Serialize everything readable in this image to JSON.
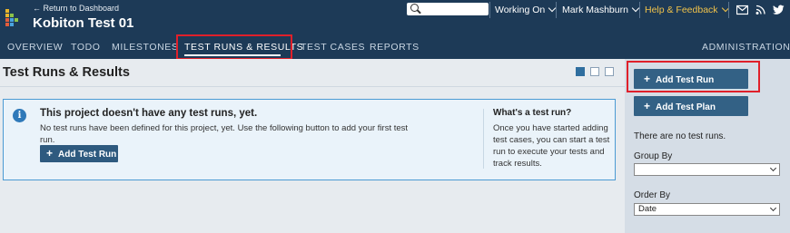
{
  "header": {
    "back_link": "← Return to Dashboard",
    "project_title": "Kobiton Test 01",
    "search": {
      "placeholder": ""
    },
    "status_menu": "Working On",
    "user_menu": "Mark Mashburn",
    "help_menu": "Help & Feedback",
    "icons": [
      "mail-icon",
      "rss-icon",
      "twitter-icon"
    ]
  },
  "nav": {
    "tabs": [
      {
        "label": "OVERVIEW"
      },
      {
        "label": "TODO"
      },
      {
        "label": "MILESTONES"
      },
      {
        "label": "TEST RUNS & RESULTS",
        "active": true
      },
      {
        "label": "TEST CASES"
      },
      {
        "label": "REPORTS"
      }
    ],
    "admin": "ADMINISTRATION"
  },
  "main": {
    "title": "Test Runs & Results",
    "view_icons": [
      "compact-view-icon",
      "list-view-icon",
      "detail-view-icon"
    ],
    "info": {
      "title": "This project doesn't have any test runs, yet.",
      "text": "No test runs have been defined for this project, yet. Use the following button to add your first test run.",
      "button": "Add Test Run",
      "side_title": "What's a test run?",
      "side_text": "Once you have started adding test cases, you can start a test run to execute your tests and track results."
    }
  },
  "sidebar": {
    "add_run": "Add Test Run",
    "add_plan": "Add Test Plan",
    "empty_text": "There are no test runs.",
    "group_by_label": "Group By",
    "group_by_value": "",
    "order_by_label": "Order By",
    "order_by_value": "Date"
  },
  "colors": {
    "header_bg": "#1d3a57",
    "button": "#2e5a7f",
    "highlight": "#e0202a",
    "help": "#f0c24a",
    "info_border": "#4b9ad3"
  }
}
